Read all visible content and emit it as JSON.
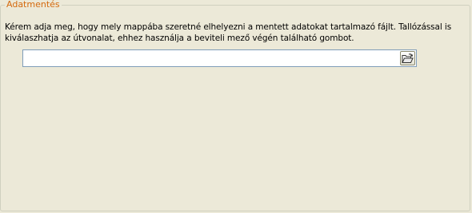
{
  "group": {
    "title": "Adatmentés"
  },
  "instructions": {
    "line1": "Kérem adja meg, hogy mely mappába szeretné elhelyezni a mentett adatokat tartalmazó fájlt. Tallózással is",
    "line2": "kiválaszhatja az útvonalat, ehhez használja a beviteli mező végén található gombot."
  },
  "path_field": {
    "value": ""
  },
  "browse_button": {
    "icon": "open-folder-icon"
  },
  "colors": {
    "background": "#ECE9D8",
    "group_title": "#D46A0E",
    "field_border": "#7F9DB9"
  }
}
